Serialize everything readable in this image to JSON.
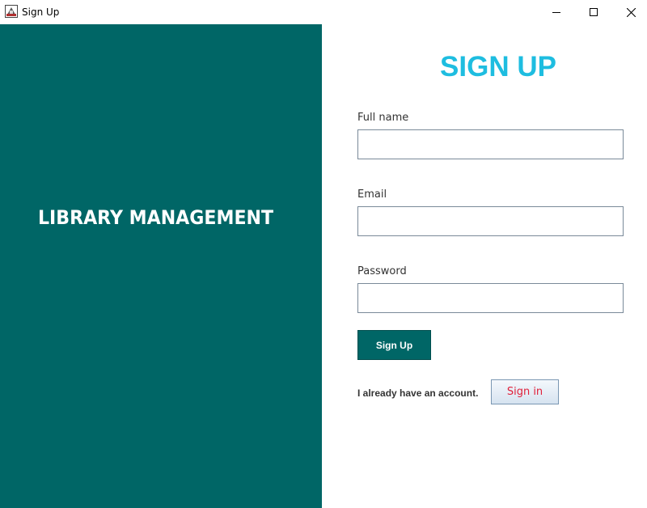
{
  "window": {
    "title": "Sign Up",
    "icons": {
      "app": "app-icon",
      "minimize": "minimize-icon",
      "maximize": "maximize-icon",
      "close": "close-icon"
    }
  },
  "brand": {
    "text": "Library Management",
    "panel_color": "#006666"
  },
  "form": {
    "heading": "SIGN UP",
    "heading_color": "#1EBDE0",
    "fields": {
      "full_name": {
        "label": "Full name",
        "value": ""
      },
      "email": {
        "label": "Email",
        "value": ""
      },
      "password": {
        "label": "Password",
        "value": ""
      }
    },
    "submit_label": "Sign Up",
    "account_prompt": "I already have an account.",
    "signin_label": "Sign in",
    "signin_color": "#E0203A"
  }
}
